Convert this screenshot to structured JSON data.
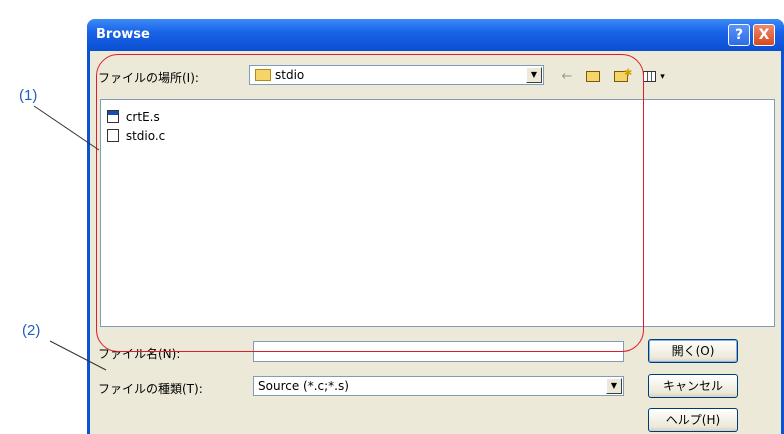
{
  "callouts": [
    "(1)",
    "(2)"
  ],
  "window": {
    "title": "Browse",
    "help_label": "?",
    "close_label": "X"
  },
  "look_in": {
    "label": "ファイルの場所(I):",
    "value": "stdio"
  },
  "toolbar": {
    "back_glyph": "←",
    "views_glyph": "▾"
  },
  "files": [
    {
      "name": "crtE.s",
      "icon": "asm-file-icon"
    },
    {
      "name": "stdio.c",
      "icon": "c-file-icon"
    }
  ],
  "file_name": {
    "label": "ファイル名(N):",
    "value": ""
  },
  "file_type": {
    "label": "ファイルの種類(T):",
    "value": "Source (*.c;*.s)"
  },
  "buttons": {
    "open": "開く(O)",
    "cancel": "キャンセル",
    "help": "ヘルプ(H)"
  },
  "colors": {
    "title_bar": "#0a4fd2",
    "callout": "#1f5fbf",
    "highlight_oval": "#e01c2a"
  }
}
